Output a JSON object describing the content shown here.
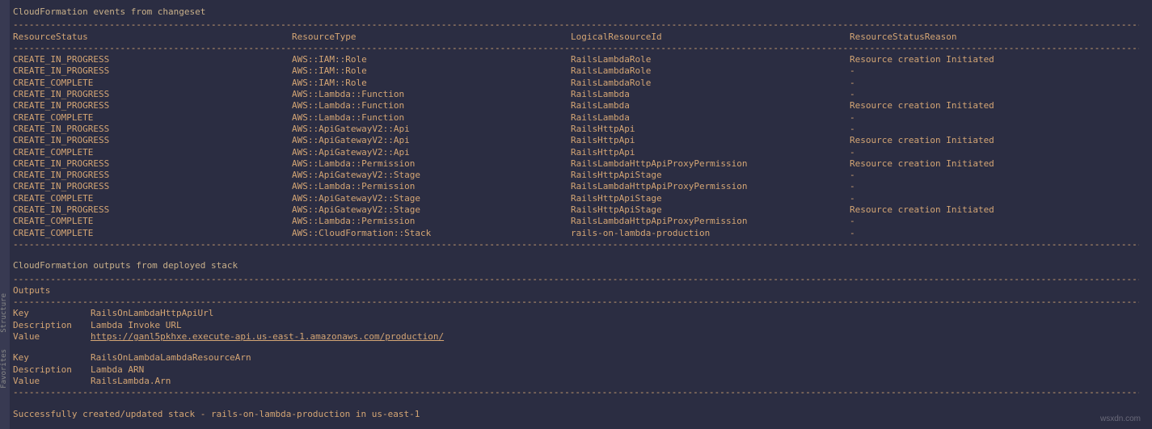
{
  "sidebar": {
    "structure": "Structure",
    "favorites": "Favorites"
  },
  "section1": {
    "title": "CloudFormation events from changeset"
  },
  "divider": "-------------------------------------------------------------------------------------------------------------------------------------------------------------------------------------------------------------------------------------------------------------",
  "headers": {
    "status": "ResourceStatus",
    "type": "ResourceType",
    "logical": "LogicalResourceId",
    "reason": "ResourceStatusReason"
  },
  "events": [
    {
      "status": "CREATE_IN_PROGRESS",
      "type": "AWS::IAM::Role",
      "logical": "RailsLambdaRole",
      "reason": "Resource creation Initiated"
    },
    {
      "status": "CREATE_IN_PROGRESS",
      "type": "AWS::IAM::Role",
      "logical": "RailsLambdaRole",
      "reason": "-"
    },
    {
      "status": "CREATE_COMPLETE",
      "type": "AWS::IAM::Role",
      "logical": "RailsLambdaRole",
      "reason": "-"
    },
    {
      "status": "CREATE_IN_PROGRESS",
      "type": "AWS::Lambda::Function",
      "logical": "RailsLambda",
      "reason": "-"
    },
    {
      "status": "CREATE_IN_PROGRESS",
      "type": "AWS::Lambda::Function",
      "logical": "RailsLambda",
      "reason": "Resource creation Initiated"
    },
    {
      "status": "CREATE_COMPLETE",
      "type": "AWS::Lambda::Function",
      "logical": "RailsLambda",
      "reason": "-"
    },
    {
      "status": "CREATE_IN_PROGRESS",
      "type": "AWS::ApiGatewayV2::Api",
      "logical": "RailsHttpApi",
      "reason": "-"
    },
    {
      "status": "CREATE_IN_PROGRESS",
      "type": "AWS::ApiGatewayV2::Api",
      "logical": "RailsHttpApi",
      "reason": "Resource creation Initiated"
    },
    {
      "status": "CREATE_COMPLETE",
      "type": "AWS::ApiGatewayV2::Api",
      "logical": "RailsHttpApi",
      "reason": "-"
    },
    {
      "status": "CREATE_IN_PROGRESS",
      "type": "AWS::Lambda::Permission",
      "logical": "RailsLambdaHttpApiProxyPermission",
      "reason": "Resource creation Initiated"
    },
    {
      "status": "CREATE_IN_PROGRESS",
      "type": "AWS::ApiGatewayV2::Stage",
      "logical": "RailsHttpApiStage",
      "reason": "-"
    },
    {
      "status": "CREATE_IN_PROGRESS",
      "type": "AWS::Lambda::Permission",
      "logical": "RailsLambdaHttpApiProxyPermission",
      "reason": "-"
    },
    {
      "status": "CREATE_COMPLETE",
      "type": "AWS::ApiGatewayV2::Stage",
      "logical": "RailsHttpApiStage",
      "reason": "-"
    },
    {
      "status": "CREATE_IN_PROGRESS",
      "type": "AWS::ApiGatewayV2::Stage",
      "logical": "RailsHttpApiStage",
      "reason": "Resource creation Initiated"
    },
    {
      "status": "CREATE_COMPLETE",
      "type": "AWS::Lambda::Permission",
      "logical": "RailsLambdaHttpApiProxyPermission",
      "reason": "-"
    },
    {
      "status": "CREATE_COMPLETE",
      "type": "AWS::CloudFormation::Stack",
      "logical": "rails-on-lambda-production",
      "reason": "-"
    }
  ],
  "section2": {
    "title": "CloudFormation outputs from deployed stack"
  },
  "outputsHeader": "Outputs",
  "labels": {
    "key": "Key",
    "description": "Description",
    "value": "Value"
  },
  "outputs": [
    {
      "key": "RailsOnLambdaHttpApiUrl",
      "description": "Lambda Invoke URL",
      "value": "https://ganl5pkhxe.execute-api.us-east-1.amazonaws.com/production/",
      "isLink": true
    },
    {
      "key": "RailsOnLambdaLambdaResourceArn",
      "description": "Lambda ARN",
      "value": "RailsLambda.Arn",
      "isLink": false
    }
  ],
  "successMsg": "Successfully created/updated stack - rails-on-lambda-production in us-east-1",
  "watermark": "wsxdn.com"
}
